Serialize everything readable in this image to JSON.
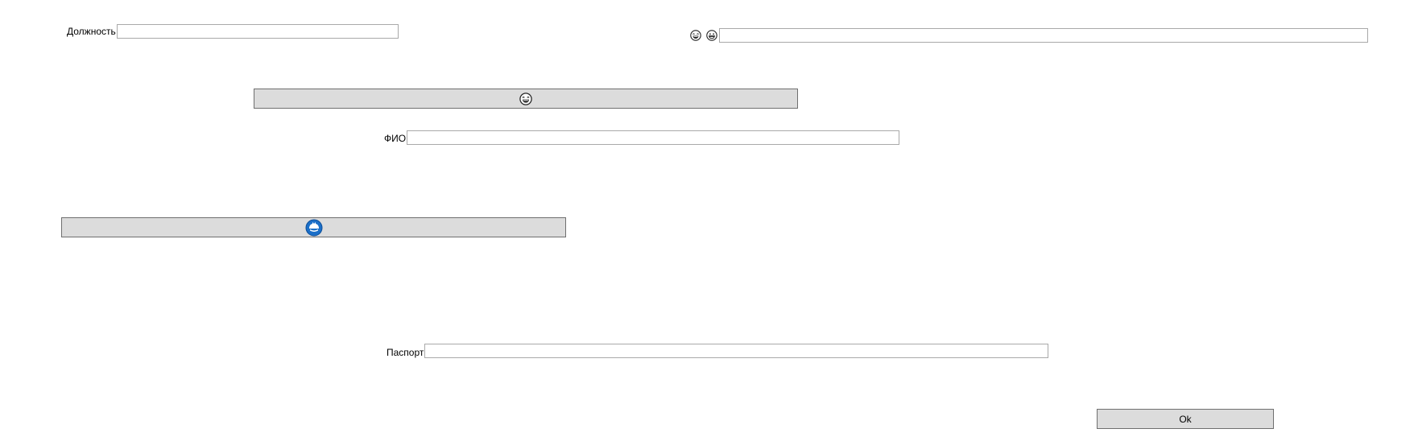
{
  "form": {
    "position_label": "Должность",
    "position_value": "",
    "fio_label": "ФИО",
    "fio_value": "",
    "passport_label": "Паспорт",
    "passport_value": "",
    "top_right_value": "",
    "ok_label": "Ok"
  },
  "icons": {
    "top_right_icon_1": "laughing-face-icon",
    "top_right_icon_2": "grinning-face-icon",
    "wide_button_icon": "laughing-face-icon",
    "lower_button_icon": "blue-circle-logo-icon"
  },
  "colors": {
    "button_bg": "#dcdcdc",
    "field_border": "#a9a9a9",
    "logo_blue": "#1b6fc8"
  }
}
